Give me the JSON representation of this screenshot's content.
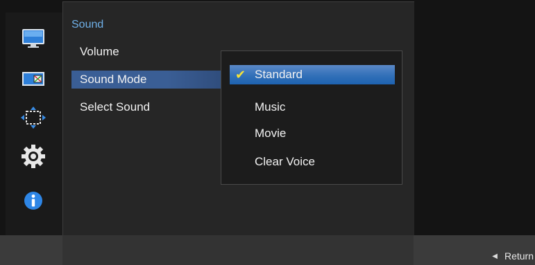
{
  "sidebar": {
    "icons": [
      {
        "name": "picture-icon"
      },
      {
        "name": "onscreen-display-icon"
      },
      {
        "name": "position-size-icon"
      },
      {
        "name": "settings-icon"
      },
      {
        "name": "information-icon"
      }
    ]
  },
  "panel": {
    "title": "Sound",
    "items": [
      {
        "label": "Volume"
      },
      {
        "label": "Sound Mode"
      },
      {
        "label": "Select Sound"
      }
    ]
  },
  "submenu": {
    "options": [
      {
        "label": "Standard"
      },
      {
        "label": "Music"
      },
      {
        "label": "Movie"
      },
      {
        "label": "Clear Voice"
      }
    ]
  },
  "footer": {
    "return_label": "Return"
  },
  "colors": {
    "accent": "#6fb0e8",
    "highlight": "#3270b8",
    "checkmark": "#f4e23a"
  }
}
